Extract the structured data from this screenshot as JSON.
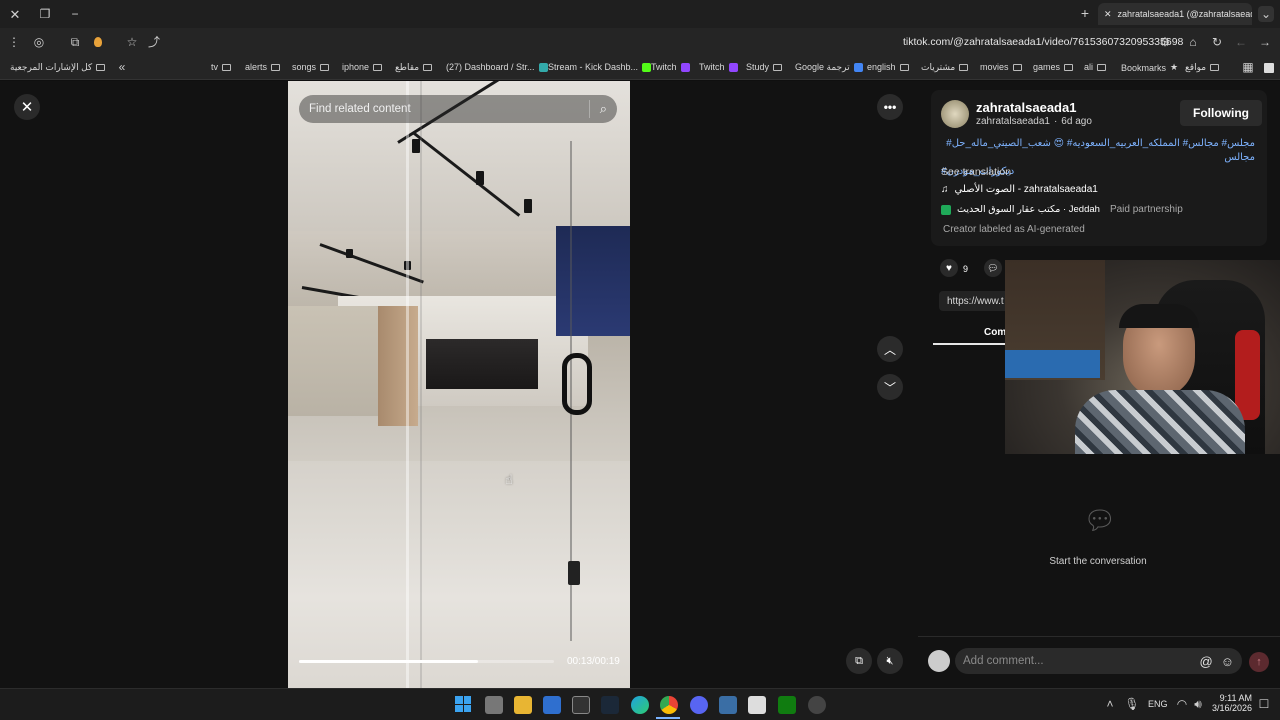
{
  "browser": {
    "tab_title": "zahratalsaeada1 (@zahratalsaeada1)",
    "url": "tiktok.com/@zahratalsaeada1/video/7615360732095335698",
    "bookmarks_right_to_left": [
      "مواقع",
      "Bookmarks",
      "ali",
      "games",
      "movies",
      "مشتريات",
      "english",
      "Google ترجمة",
      "Study",
      "Twitch",
      "Twitch",
      "Stream - Kick Dashb...",
      "(27) Dashboard / Str...",
      "مقاطع",
      "iphone",
      "songs",
      "alerts",
      "tv"
    ],
    "all_bookmarks": "كل الإشارات المرجعية"
  },
  "video": {
    "search_placeholder": "Find related content",
    "time": "00:13/00:19",
    "progress": 0.7
  },
  "post": {
    "username": "zahratalsaeada1",
    "handle": "zahratalsaeada1",
    "age": "6d ago",
    "follow_label": "Following",
    "caption_line1": "مجلس# مجالس# المملكه_العربيه_السعوديه# 😍 شعب_الصيني_ماله_حل# مجالس",
    "caption_line2": "ديكورات_مودرن#",
    "see_translation": "See translation",
    "sound": "الصوت الأصلي - zahratalsaeada1",
    "location": "مكتب عقار السوق الحديث · Jeddah",
    "paid": "Paid partnership",
    "ai_label": "Creator labeled as AI-generated",
    "likes": "9",
    "link_preview": "https://www.t",
    "comments_tab": "Com",
    "empty_comments": "Start the conversation",
    "comment_placeholder": "Add comment..."
  },
  "taskbar": {
    "lang": "ENG",
    "time": "9:11 AM",
    "date": "3/16/2026"
  },
  "colors": {
    "link_blue": "#7eb3ff",
    "send_button": "#5c2a2f"
  }
}
